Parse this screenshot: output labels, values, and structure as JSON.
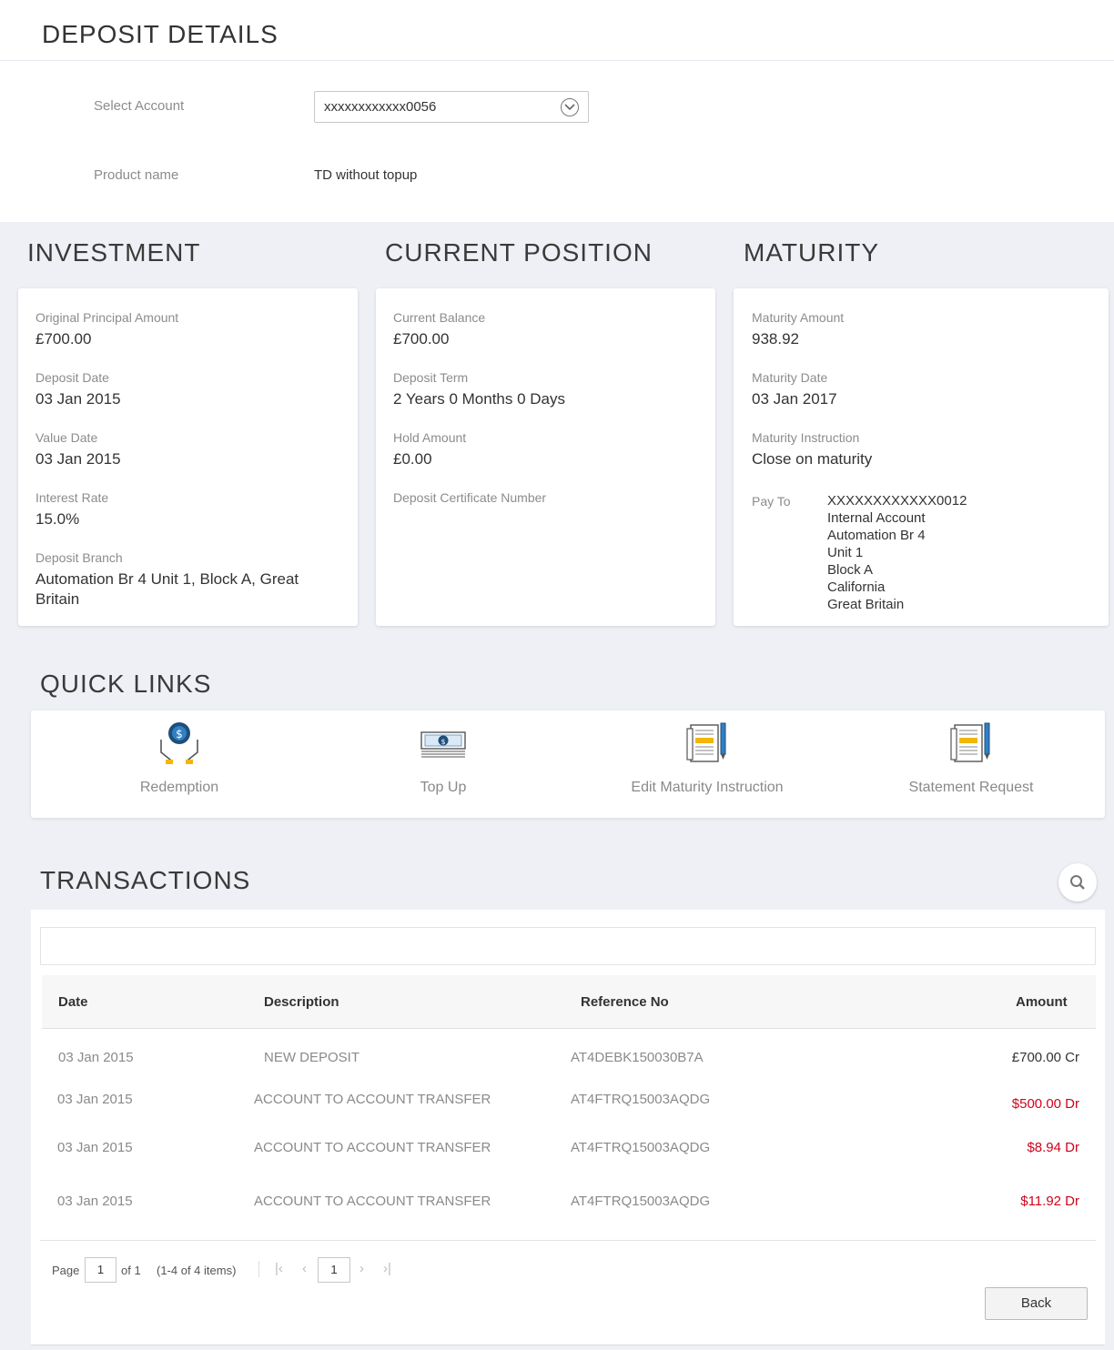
{
  "header": {
    "title": "DEPOSIT DETAILS",
    "select_account_label": "Select Account",
    "selected_account": "xxxxxxxxxxxx0056",
    "product_name_label": "Product name",
    "product_name": "TD without topup"
  },
  "investment": {
    "heading": "INVESTMENT",
    "original_principal_label": "Original Principal Amount",
    "original_principal": "£700.00",
    "deposit_date_label": "Deposit Date",
    "deposit_date": "03 Jan 2015",
    "value_date_label": "Value Date",
    "value_date": "03 Jan 2015",
    "interest_rate_label": "Interest Rate",
    "interest_rate": "15.0%",
    "deposit_branch_label": "Deposit Branch",
    "deposit_branch": "Automation Br 4 Unit 1, Block A, Great Britain"
  },
  "current_position": {
    "heading": "CURRENT POSITION",
    "current_balance_label": "Current Balance",
    "current_balance": "£700.00",
    "deposit_term_label": "Deposit Term",
    "deposit_term": "2 Years 0 Months 0 Days",
    "hold_amount_label": "Hold Amount",
    "hold_amount": "£0.00",
    "certificate_label": "Deposit Certificate Number"
  },
  "maturity": {
    "heading": "MATURITY",
    "maturity_amount_label": "Maturity Amount",
    "maturity_amount": "938.92",
    "maturity_date_label": "Maturity Date",
    "maturity_date": "03 Jan 2017",
    "instruction_label": "Maturity Instruction",
    "instruction": "Close on maturity",
    "pay_to_label": "Pay To",
    "pay_to": [
      "XXXXXXXXXXXX0012",
      "Internal Account",
      "Automation Br 4",
      "Unit 1",
      "Block A",
      "California",
      "Great Britain"
    ]
  },
  "quick_links": {
    "heading": "QUICK LINKS",
    "items": [
      {
        "label": "Redemption",
        "icon": "redemption-icon"
      },
      {
        "label": "Top Up",
        "icon": "top-up-icon"
      },
      {
        "label": "Edit Maturity Instruction",
        "icon": "edit-maturity-icon"
      },
      {
        "label": "Statement Request",
        "icon": "statement-request-icon"
      }
    ]
  },
  "transactions": {
    "heading": "TRANSACTIONS",
    "columns": {
      "date": "Date",
      "description": "Description",
      "reference": "Reference No",
      "amount": "Amount"
    },
    "rows": [
      {
        "date": "03 Jan 2015",
        "description": "NEW DEPOSIT",
        "reference": "AT4DEBK150030B7A",
        "amount": "£700.00 Cr",
        "type": "cr"
      },
      {
        "date": "03 Jan 2015",
        "description": "ACCOUNT TO ACCOUNT TRANSFER",
        "reference": "AT4FTRQ15003AQDG",
        "amount": "$500.00 Dr",
        "type": "dr"
      },
      {
        "date": "03 Jan 2015",
        "description": "ACCOUNT TO ACCOUNT TRANSFER",
        "reference": "AT4FTRQ15003AQDG",
        "amount": "$8.94 Dr",
        "type": "dr"
      },
      {
        "date": "03 Jan 2015",
        "description": "ACCOUNT TO ACCOUNT TRANSFER",
        "reference": "AT4FTRQ15003AQDG",
        "amount": "$11.92 Dr",
        "type": "dr"
      }
    ],
    "pager": {
      "page_label": "Page",
      "page_value": "1",
      "of_label": "of 1",
      "items_label": "(1-4 of 4 items)",
      "current_page": "1"
    },
    "back_label": "Back"
  },
  "colors": {
    "debit": "#d0021b",
    "accent": "#2a6ebb"
  }
}
